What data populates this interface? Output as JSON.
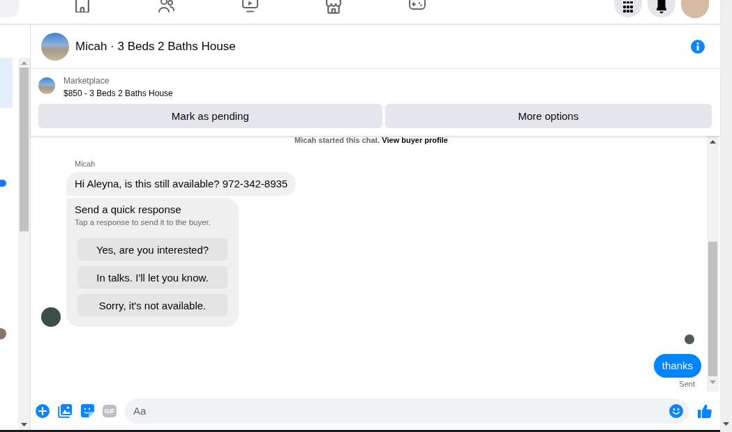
{
  "conversation_list": {
    "items": [
      {
        "selected": true,
        "unread": false,
        "seen": false
      },
      {
        "selected": false,
        "unread": false,
        "seen": false
      },
      {
        "selected": false,
        "unread": true,
        "seen": false
      },
      {
        "selected": false,
        "unread": false,
        "seen": false
      },
      {
        "selected": false,
        "unread": false,
        "seen": false
      },
      {
        "selected": false,
        "unread": false,
        "seen": true
      },
      {
        "selected": false,
        "unread": false,
        "seen": false
      }
    ]
  },
  "header": {
    "title": "Micah · 3 Beds 2 Baths House"
  },
  "listing": {
    "source": "Marketplace",
    "title": "$850 - 3 Beds 2 Baths House",
    "actions": [
      "Mark as pending",
      "More options"
    ]
  },
  "chat": {
    "notice": {
      "text": "Micah started this chat.",
      "link": "View buyer profile"
    },
    "incoming": {
      "sender": "Micah",
      "message": "Hi Aleyna, is this still available? 972-342-8935",
      "quick_response": {
        "title": "Send a quick response",
        "subtitle": "Tap a response to send it to the buyer.",
        "options": [
          "Yes, are you interested?",
          "In talks. I'll let you know.",
          "Sorry, it's not available."
        ]
      }
    },
    "outgoing": {
      "message": "thanks",
      "status": "Sent",
      "seen": true
    }
  },
  "composer": {
    "gif_label": "GIF",
    "placeholder": "Aa"
  }
}
